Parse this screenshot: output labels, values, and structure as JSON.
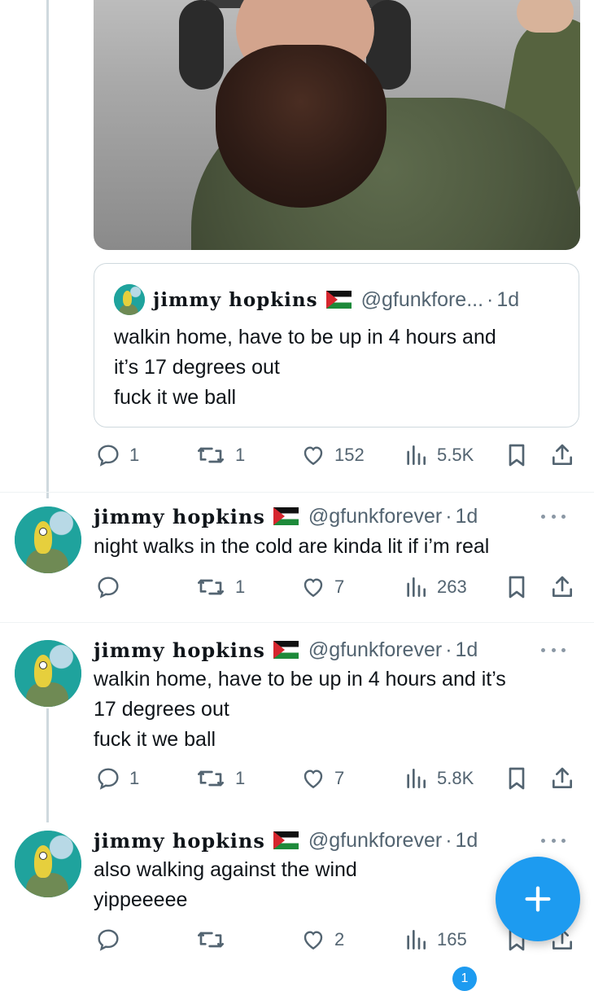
{
  "colors": {
    "accent": "#1d9bf0",
    "text": "#0f1419",
    "muted": "#536471",
    "border": "#cfd9de"
  },
  "media": {
    "description_icon": "photo-selfie"
  },
  "quoted_tweet": {
    "name": "jimmy hopkins",
    "handle": "@gfunkfore...",
    "dot": "·",
    "time": "1d",
    "text": "walkin home, have to be up in 4 hours and\nit’s 17 degrees out\nfuck it we ball"
  },
  "tweet0_actions": {
    "replies": "1",
    "retweets": "1",
    "likes": "152",
    "views": "5.5K"
  },
  "tweets": [
    {
      "name": "jimmy hopkins",
      "handle": "@gfunkforever",
      "dot": "·",
      "time": "1d",
      "text": "night walks in the cold are kinda lit if i’m real",
      "replies": "",
      "retweets": "1",
      "likes": "7",
      "views": "263"
    },
    {
      "name": "jimmy hopkins",
      "handle": "@gfunkforever",
      "dot": "·",
      "time": "1d",
      "text": "walkin home, have to be up in 4 hours and it’s\n17 degrees out\nfuck it we ball",
      "replies": "1",
      "retweets": "1",
      "likes": "7",
      "views": "5.8K"
    },
    {
      "name": "jimmy hopkins",
      "handle": "@gfunkforever",
      "dot": "·",
      "time": "1d",
      "text": "also walking against the wind\nyippeeeee",
      "replies": "",
      "retweets": "",
      "likes": "2",
      "views": "165"
    }
  ],
  "fab": {
    "icon": "plus-icon"
  },
  "bottom_nav": {
    "notification_count": "1"
  }
}
